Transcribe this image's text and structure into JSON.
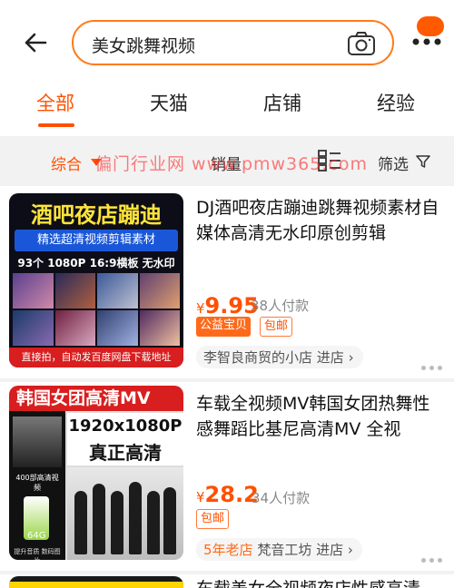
{
  "search": {
    "query": "美女跳舞视频"
  },
  "tabs": [
    {
      "label": "全部",
      "active": true
    },
    {
      "label": "天猫"
    },
    {
      "label": "店铺"
    },
    {
      "label": "经验"
    }
  ],
  "sort": {
    "comprehensive": "综合",
    "sales": "销量",
    "filter": "筛选"
  },
  "watermark": "偏门行业网 www.pmw365.com",
  "products": [
    {
      "title": "DJ酒吧夜店蹦迪跳舞视频素材自媒体高清无水印原创剪辑",
      "price_symbol": "¥",
      "price": "9.95",
      "sold": "38人付款",
      "tags": [
        "公益宝贝",
        "包邮"
      ],
      "shop": "李智良商贸的小店",
      "shop_link": "进店",
      "thumb": {
        "title": "酒吧夜店蹦迪",
        "subtitle": "精选超清视频剪辑素材",
        "specs": "93个 1080P 16:9横板 无水印",
        "bottom": "直接拍，自动发百度网盘下载地址"
      }
    },
    {
      "title": "车载全视频MV韩国女团热舞性感舞蹈比基尼高清MV 全视",
      "price_symbol": "¥",
      "price": "28.2",
      "sold": "34人付款",
      "tags": [
        "包邮"
      ],
      "shop_age": "5年老店",
      "shop": "梵音工坊",
      "shop_link": "进店",
      "thumb": {
        "title": "韩国女团高清MV",
        "resolution": "1920x1080P",
        "hd": "真正高清",
        "usb_label": "64G",
        "caption_left": "400部高清视频",
        "caption_bottom": "提升音质 数码图片"
      }
    },
    {
      "title": "车载美女全视频夜店性感高清"
    }
  ],
  "colors": {
    "accent": "#ff5000",
    "search_border": "#ff7a1a"
  }
}
